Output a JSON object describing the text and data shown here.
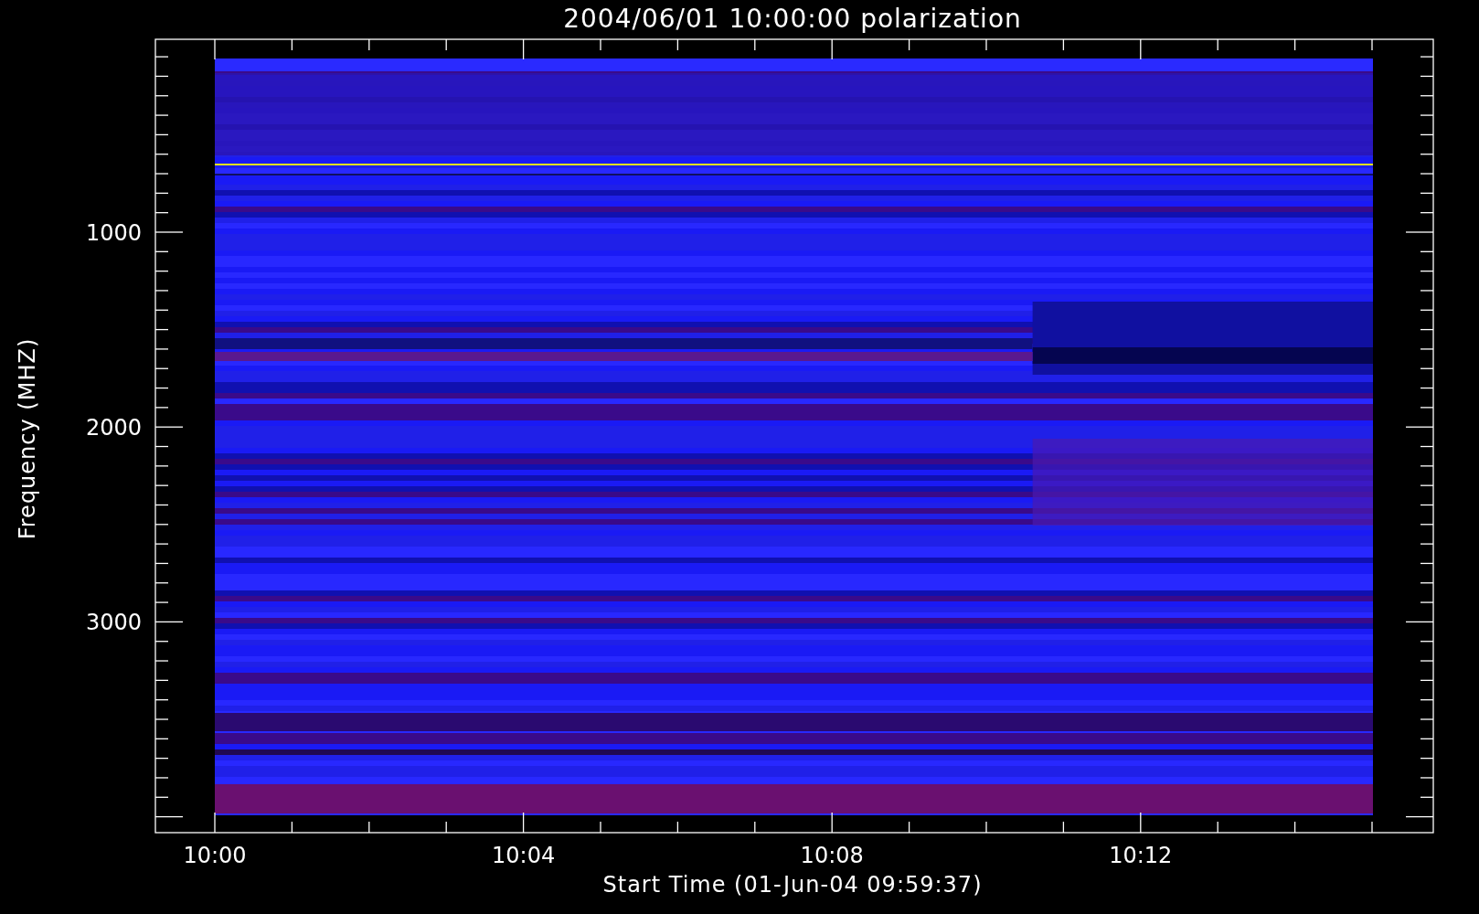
{
  "title": "2004/06/01 10:00:00 polarization",
  "y_axis": {
    "label": "Frequency (MHZ)",
    "ticks": [
      "1000",
      "2000",
      "3000"
    ]
  },
  "x_axis": {
    "label": "Start Time (01-Jun-04 09:59:37)",
    "ticks": [
      "10:00",
      "10:04",
      "10:08",
      "10:12"
    ]
  }
}
